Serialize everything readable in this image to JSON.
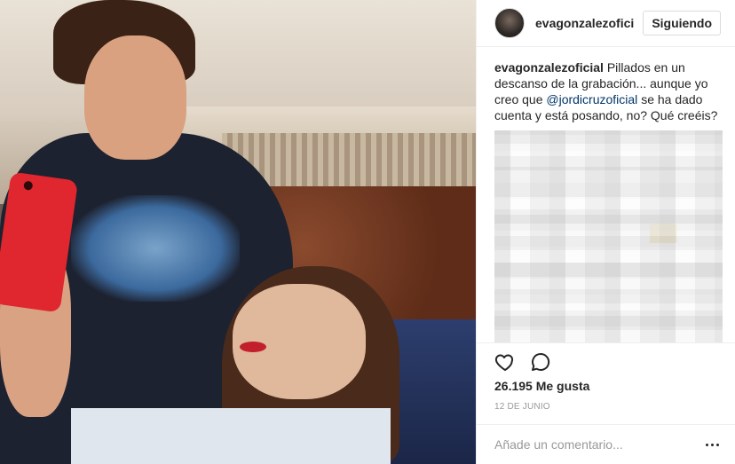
{
  "post": {
    "author": {
      "username": "evagonzalezofici",
      "avatar_icon": "avatar-photo"
    },
    "follow_button": "Siguiendo",
    "caption": {
      "username": "evagonzalezoficial",
      "text_before": "Pillados en un descanso de la grabación... aunque yo creo que",
      "mention": "@jordicruzoficial",
      "text_after": "se ha dado cuenta y está posando, no? Qué creéis?"
    },
    "icons": {
      "like": "heart-icon",
      "comment": "speech-bubble-icon",
      "more": "ellipsis-icon"
    },
    "likes": "26.195 Me gusta",
    "date": "12 DE JUNIO",
    "comment_placeholder": "Añade un comentario...",
    "colors": {
      "mention": "#003569",
      "border": "#efefef",
      "muted": "#999999"
    }
  }
}
